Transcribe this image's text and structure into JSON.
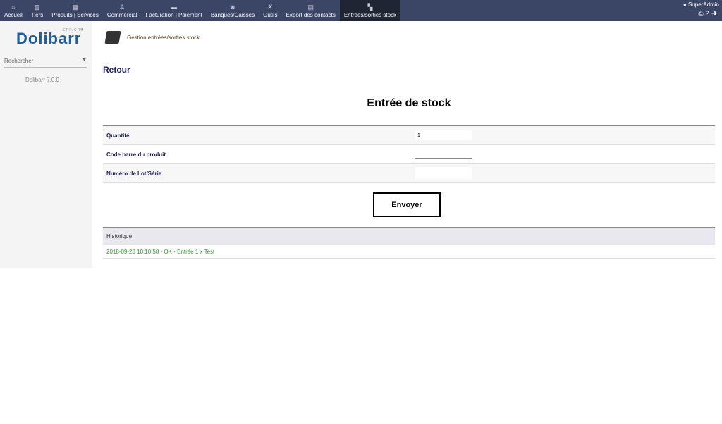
{
  "menu": [
    {
      "label": "Accueil",
      "icon": "home-icon"
    },
    {
      "label": "Tiers",
      "icon": "company-icon"
    },
    {
      "label": "Produits | Services",
      "icon": "products-icon"
    },
    {
      "label": "Commercial",
      "icon": "commercial-icon"
    },
    {
      "label": "Facturation | Paiement",
      "icon": "billing-icon"
    },
    {
      "label": "Banques/Caisses",
      "icon": "bank-icon"
    },
    {
      "label": "Outils",
      "icon": "tools-icon"
    },
    {
      "label": "Export des contacts",
      "icon": "database-icon"
    },
    {
      "label": "Entrées/sorties stock",
      "icon": "barcode-scanner-icon"
    }
  ],
  "user": {
    "name": "SuperAdmin"
  },
  "sidebar": {
    "logo": "Dolibarr",
    "logo_sub": "ERP/CRM",
    "search_placeholder": "Rechercher",
    "version": "Dolibarr 7.0.0"
  },
  "page": {
    "header": "Gestion entrées/sorties stock",
    "back": "Retour",
    "title": "Entrée de stock"
  },
  "form": {
    "quantity_label": "Quantité",
    "quantity_value": "1",
    "barcode_label": "Code barre du produit",
    "barcode_value": "",
    "lot_label": "Numéro de Lot/Série",
    "lot_value": "",
    "submit": "Envoyer"
  },
  "history": {
    "header": "Historique",
    "rows": [
      "2018-09-28 10:10:58 - OK - Entrée 1 x Test"
    ]
  }
}
